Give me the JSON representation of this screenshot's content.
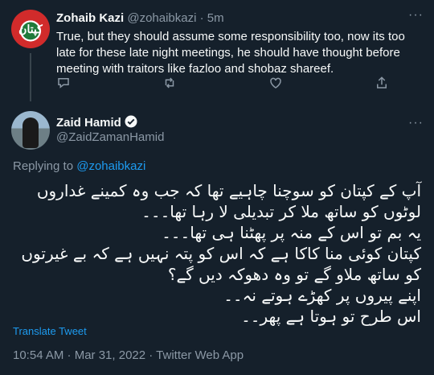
{
  "reply": {
    "avatar_text": "کپتان",
    "display_name": "Zohaib Kazi",
    "handle": "@zohaibkazi",
    "separator": " · ",
    "time": "5m",
    "more": "···",
    "text": "True, but they should assume some responsibility too, now its too late for these late night meetings, he should have thought before meeting with traitors like fazloo and shobaz shareef.",
    "actions": [
      "reply-icon",
      "retweet-icon",
      "like-icon",
      "share-icon"
    ]
  },
  "tweet": {
    "display_name": "Zaid Hamid",
    "handle": "@ZaidZamanHamid",
    "more": "···",
    "replying_prefix": "Replying to ",
    "replying_to": "@zohaibkazi",
    "lines": [
      "آپ کے کپتان کو سوچنا چاہیے تھا کہ جب وہ کمینے غداروں",
      "لوٹوں کو ساتھ ملا کر تبدیلی لا رہا تھا۔۔۔",
      "یہ بم تو اس کے منہ پر پھٹنا ہی تھا۔۔۔",
      "کپتان کوئی منا کاکا ہے کہ اس کو پتہ نہیں ہے کہ بے غیرتوں",
      "کو ساتھ ملاو گے تو وہ دھوکہ دیں گے؟",
      "اپنے پیروں پر کھڑے ہوتے نہ۔۔",
      "اس طرح تو ہوتا ہے پھر۔۔"
    ],
    "translate_label": "Translate Tweet",
    "timestamp": "10:54 AM · Mar 31, 2022 · Twitter Web App"
  },
  "colors": {
    "background": "#15202b",
    "text": "#f7f9f9",
    "muted": "#8b98a5",
    "link": "#1d9bf0"
  }
}
